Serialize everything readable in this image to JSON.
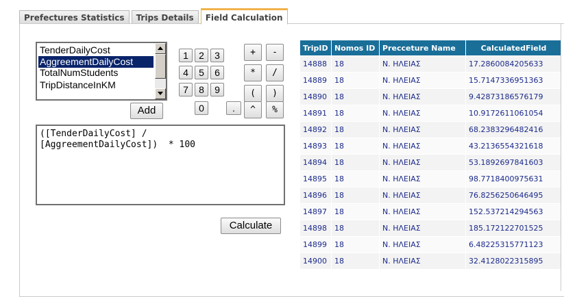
{
  "tabs": [
    {
      "label": "Prefectures Statistics",
      "active": false
    },
    {
      "label": "Trips Details",
      "active": false
    },
    {
      "label": "Field Calculation",
      "active": true
    }
  ],
  "fields_list": {
    "items": [
      "TenderDailyCost",
      "AggreementDailyCost",
      "TotalNumStudents",
      "TripDistanceInKM"
    ],
    "selected": "AggreementDailyCost"
  },
  "keypad": {
    "digits": [
      "1",
      "2",
      "3",
      "4",
      "5",
      "6",
      "7",
      "8",
      "9",
      "0",
      "."
    ],
    "operators": [
      "+",
      "-",
      "*",
      "/",
      "(",
      ")",
      "^",
      "%"
    ]
  },
  "add_label": "Add",
  "formula_text": "([TenderDailyCost] /\n[AggreementDailyCost])  * 100",
  "calculate_label": "Calculate",
  "table": {
    "columns": [
      "TripID",
      "Nomos ID",
      "Precceture Name",
      "CalculatedField"
    ],
    "rows": [
      [
        "14888",
        "18",
        "Ν. ΗΛΕΙΑΣ",
        "17.2860084205633"
      ],
      [
        "14889",
        "18",
        "Ν. ΗΛΕΙΑΣ",
        "15.7147336951363"
      ],
      [
        "14890",
        "18",
        "Ν. ΗΛΕΙΑΣ",
        "9.42873186576179"
      ],
      [
        "14891",
        "18",
        "Ν. ΗΛΕΙΑΣ",
        "10.9172611061054"
      ],
      [
        "14892",
        "18",
        "Ν. ΗΛΕΙΑΣ",
        "68.2383296482416"
      ],
      [
        "14893",
        "18",
        "Ν. ΗΛΕΙΑΣ",
        "43.2136554321618"
      ],
      [
        "14894",
        "18",
        "Ν. ΗΛΕΙΑΣ",
        "53.1892697841603"
      ],
      [
        "14895",
        "18",
        "Ν. ΗΛΕΙΑΣ",
        "98.7718400975631"
      ],
      [
        "14896",
        "18",
        "Ν. ΗΛΕΙΑΣ",
        "76.8256250646495"
      ],
      [
        "14897",
        "18",
        "Ν. ΗΛΕΙΑΣ",
        "152.537214294563"
      ],
      [
        "14898",
        "18",
        "Ν. ΗΛΕΙΑΣ",
        "185.172122701525"
      ],
      [
        "14899",
        "18",
        "Ν. ΗΛΕΙΑΣ",
        "6.48225315771123"
      ],
      [
        "14900",
        "18",
        "Ν. ΗΛΕΙΑΣ",
        "32.4128022315895"
      ]
    ]
  },
  "colors": {
    "header_bg": "#1a6f99",
    "cell_text": "#1b2a8a",
    "selection_bg": "#0a246a",
    "active_tab_accent": "#f0b24a"
  },
  "icons": {
    "scroll_up": "triangle-up-icon",
    "scroll_down": "triangle-down-icon"
  }
}
